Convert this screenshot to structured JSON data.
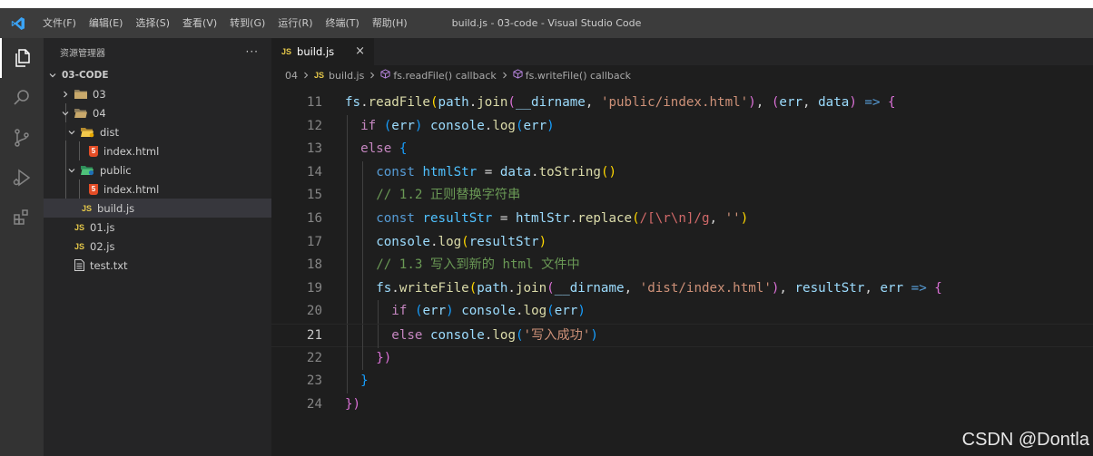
{
  "window": {
    "title": "build.js - 03-code - Visual Studio Code"
  },
  "menu": [
    "文件(F)",
    "编辑(E)",
    "选择(S)",
    "查看(V)",
    "转到(G)",
    "运行(R)",
    "终端(T)",
    "帮助(H)"
  ],
  "activity_bar": [
    "files-icon",
    "search-icon",
    "source-control-icon",
    "run-debug-icon",
    "extensions-icon"
  ],
  "sidebar": {
    "title": "资源管理器",
    "more": "···",
    "root": "03-CODE",
    "tree": [
      {
        "label": "03",
        "type": "folder",
        "expanded": false
      },
      {
        "label": "04",
        "type": "folder",
        "expanded": true
      },
      {
        "label": "dist",
        "type": "folder",
        "expanded": true
      },
      {
        "label": "index.html",
        "type": "html"
      },
      {
        "label": "public",
        "type": "folder",
        "expanded": true
      },
      {
        "label": "index.html",
        "type": "html"
      },
      {
        "label": "build.js",
        "type": "js",
        "selected": true
      },
      {
        "label": "01.js",
        "type": "js"
      },
      {
        "label": "02.js",
        "type": "js"
      },
      {
        "label": "test.txt",
        "type": "txt"
      }
    ]
  },
  "tab": {
    "label": "build.js",
    "badge": "JS",
    "close": "×"
  },
  "breadcrumb": [
    "04",
    "build.js",
    "fs.readFile() callback",
    "fs.writeFile() callback"
  ],
  "code": {
    "current_line": 21,
    "lines": [
      {
        "n": "11",
        "indent": 0,
        "tokens": [
          [
            "fs",
            "t-var"
          ],
          [
            ".",
            "t-op"
          ],
          [
            "readFile",
            "t-fn"
          ],
          [
            "(",
            "t-p1"
          ],
          [
            "path",
            "t-var"
          ],
          [
            ".",
            "t-op"
          ],
          [
            "join",
            "t-fn"
          ],
          [
            "(",
            "t-p2"
          ],
          [
            "__dirname",
            "t-var"
          ],
          [
            ", ",
            "t-op"
          ],
          [
            "'public/index.html'",
            "t-str"
          ],
          [
            ")",
            "t-p2"
          ],
          [
            ", ",
            "t-op"
          ],
          [
            "(",
            "t-p2"
          ],
          [
            "err",
            "t-var"
          ],
          [
            ", ",
            "t-op"
          ],
          [
            "data",
            "t-var"
          ],
          [
            ")",
            "t-p2"
          ],
          [
            " ",
            "t-op"
          ],
          [
            "=>",
            "t-kw"
          ],
          [
            " ",
            "t-op"
          ],
          [
            "{",
            "t-p2"
          ]
        ]
      },
      {
        "n": "12",
        "indent": 1,
        "tokens": [
          [
            "if",
            "t-kw-ctrl"
          ],
          [
            " ",
            "t-op"
          ],
          [
            "(",
            "t-p3"
          ],
          [
            "err",
            "t-var"
          ],
          [
            ")",
            "t-p3"
          ],
          [
            " ",
            "t-op"
          ],
          [
            "console",
            "t-var"
          ],
          [
            ".",
            "t-op"
          ],
          [
            "log",
            "t-fn"
          ],
          [
            "(",
            "t-p3"
          ],
          [
            "err",
            "t-var"
          ],
          [
            ")",
            "t-p3"
          ]
        ]
      },
      {
        "n": "13",
        "indent": 1,
        "tokens": [
          [
            "else",
            "t-kw-ctrl"
          ],
          [
            " ",
            "t-op"
          ],
          [
            "{",
            "t-p3"
          ]
        ]
      },
      {
        "n": "14",
        "indent": 2,
        "tokens": [
          [
            "const",
            "t-kw"
          ],
          [
            " ",
            "t-op"
          ],
          [
            "htmlStr",
            "t-const"
          ],
          [
            " = ",
            "t-op"
          ],
          [
            "data",
            "t-var"
          ],
          [
            ".",
            "t-op"
          ],
          [
            "toString",
            "t-fn"
          ],
          [
            "()",
            "t-p1"
          ]
        ]
      },
      {
        "n": "15",
        "indent": 2,
        "tokens": [
          [
            "// 1.2 正则替换字符串",
            "t-cmt"
          ]
        ]
      },
      {
        "n": "16",
        "indent": 2,
        "tokens": [
          [
            "const",
            "t-kw"
          ],
          [
            " ",
            "t-op"
          ],
          [
            "resultStr",
            "t-const"
          ],
          [
            " = ",
            "t-op"
          ],
          [
            "htmlStr",
            "t-var"
          ],
          [
            ".",
            "t-op"
          ],
          [
            "replace",
            "t-fn"
          ],
          [
            "(",
            "t-p1"
          ],
          [
            "/[\\r\\n]/g",
            "t-regex"
          ],
          [
            ", ",
            "t-op"
          ],
          [
            "''",
            "t-str"
          ],
          [
            ")",
            "t-p1"
          ]
        ]
      },
      {
        "n": "17",
        "indent": 2,
        "tokens": [
          [
            "console",
            "t-var"
          ],
          [
            ".",
            "t-op"
          ],
          [
            "log",
            "t-fn"
          ],
          [
            "(",
            "t-p1"
          ],
          [
            "resultStr",
            "t-var"
          ],
          [
            ")",
            "t-p1"
          ]
        ]
      },
      {
        "n": "18",
        "indent": 2,
        "tokens": [
          [
            "// 1.3 写入到新的 html 文件中",
            "t-cmt"
          ]
        ]
      },
      {
        "n": "19",
        "indent": 2,
        "tokens": [
          [
            "fs",
            "t-var"
          ],
          [
            ".",
            "t-op"
          ],
          [
            "writeFile",
            "t-fn"
          ],
          [
            "(",
            "t-p1"
          ],
          [
            "path",
            "t-var"
          ],
          [
            ".",
            "t-op"
          ],
          [
            "join",
            "t-fn"
          ],
          [
            "(",
            "t-p2"
          ],
          [
            "__dirname",
            "t-var"
          ],
          [
            ", ",
            "t-op"
          ],
          [
            "'dist/index.html'",
            "t-str"
          ],
          [
            ")",
            "t-p2"
          ],
          [
            ", ",
            "t-op"
          ],
          [
            "resultStr",
            "t-var"
          ],
          [
            ", ",
            "t-op"
          ],
          [
            "err",
            "t-var"
          ],
          [
            " ",
            "t-op"
          ],
          [
            "=>",
            "t-kw"
          ],
          [
            " ",
            "t-op"
          ],
          [
            "{",
            "t-p2"
          ]
        ]
      },
      {
        "n": "20",
        "indent": 3,
        "tokens": [
          [
            "if",
            "t-kw-ctrl"
          ],
          [
            " ",
            "t-op"
          ],
          [
            "(",
            "t-p3"
          ],
          [
            "err",
            "t-var"
          ],
          [
            ")",
            "t-p3"
          ],
          [
            " ",
            "t-op"
          ],
          [
            "console",
            "t-var"
          ],
          [
            ".",
            "t-op"
          ],
          [
            "log",
            "t-fn"
          ],
          [
            "(",
            "t-p3"
          ],
          [
            "err",
            "t-var"
          ],
          [
            ")",
            "t-p3"
          ]
        ]
      },
      {
        "n": "21",
        "indent": 3,
        "tokens": [
          [
            "else",
            "t-kw-ctrl"
          ],
          [
            " ",
            "t-op"
          ],
          [
            "console",
            "t-var"
          ],
          [
            ".",
            "t-op"
          ],
          [
            "log",
            "t-fn"
          ],
          [
            "(",
            "t-p3"
          ],
          [
            "'写入成功'",
            "t-str"
          ],
          [
            ")",
            "t-p3"
          ]
        ]
      },
      {
        "n": "22",
        "indent": 2,
        "tokens": [
          [
            "})",
            "t-p2"
          ]
        ]
      },
      {
        "n": "23",
        "indent": 1,
        "tokens": [
          [
            "}",
            "t-p3"
          ]
        ]
      },
      {
        "n": "24",
        "indent": 0,
        "tokens": [
          [
            "})",
            "t-p2"
          ]
        ]
      }
    ]
  },
  "watermark": "CSDN @Dontla"
}
